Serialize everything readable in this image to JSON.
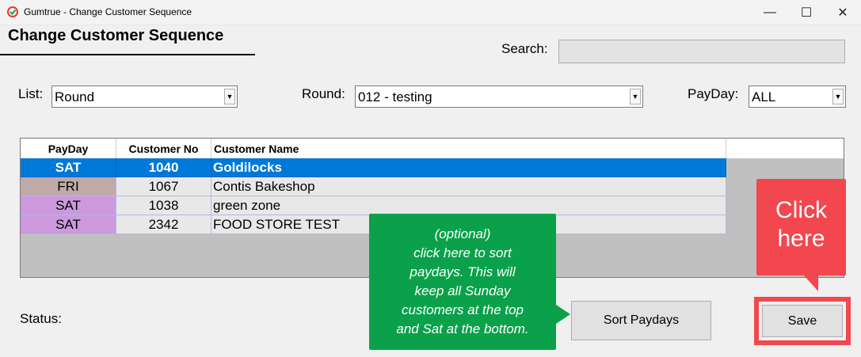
{
  "window": {
    "title": "Gumtrue - Change Customer Sequence",
    "min_glyph": "—",
    "max_glyph": "☐",
    "close_glyph": "✕"
  },
  "page": {
    "heading": "Change Customer Sequence"
  },
  "search": {
    "label": "Search:",
    "value": ""
  },
  "filters": {
    "list": {
      "label": "List:",
      "value": "Round"
    },
    "round": {
      "label": "Round:",
      "value": "012 - testing"
    },
    "payday": {
      "label": "PayDay:",
      "value": "ALL"
    }
  },
  "grid": {
    "columns": [
      "PayDay",
      "Customer No",
      "Customer Name"
    ],
    "rows": [
      {
        "payday": "SAT",
        "customer_no": "1040",
        "customer_name": "Goldilocks",
        "selected": true,
        "payday_color": "#0078d7"
      },
      {
        "payday": "FRI",
        "customer_no": "1067",
        "customer_name": "Contis Bakeshop",
        "selected": false,
        "payday_color": "#c0aaa8"
      },
      {
        "payday": "SAT",
        "customer_no": "1038",
        "customer_name": "green zone",
        "selected": false,
        "payday_color": "#cc99dd"
      },
      {
        "payday": "SAT",
        "customer_no": "2342",
        "customer_name": "FOOD STORE TEST",
        "selected": false,
        "payday_color": "#cc99dd"
      }
    ],
    "selection_color": "#0078d7",
    "row_color": "#e8e8e8"
  },
  "status": {
    "label": "Status:",
    "value": ""
  },
  "buttons": {
    "sort_paydays": "Sort Paydays",
    "save": "Save"
  },
  "annotations": {
    "green_callout": [
      "(optional)",
      "click here to sort",
      "paydays. This will",
      "keep all Sunday",
      "customers at the top",
      "and Sat at the bottom."
    ],
    "red_callout": [
      "Click",
      "here"
    ]
  },
  "colors": {
    "callout_green": "#0aa14a",
    "callout_red": "#f2474e"
  }
}
